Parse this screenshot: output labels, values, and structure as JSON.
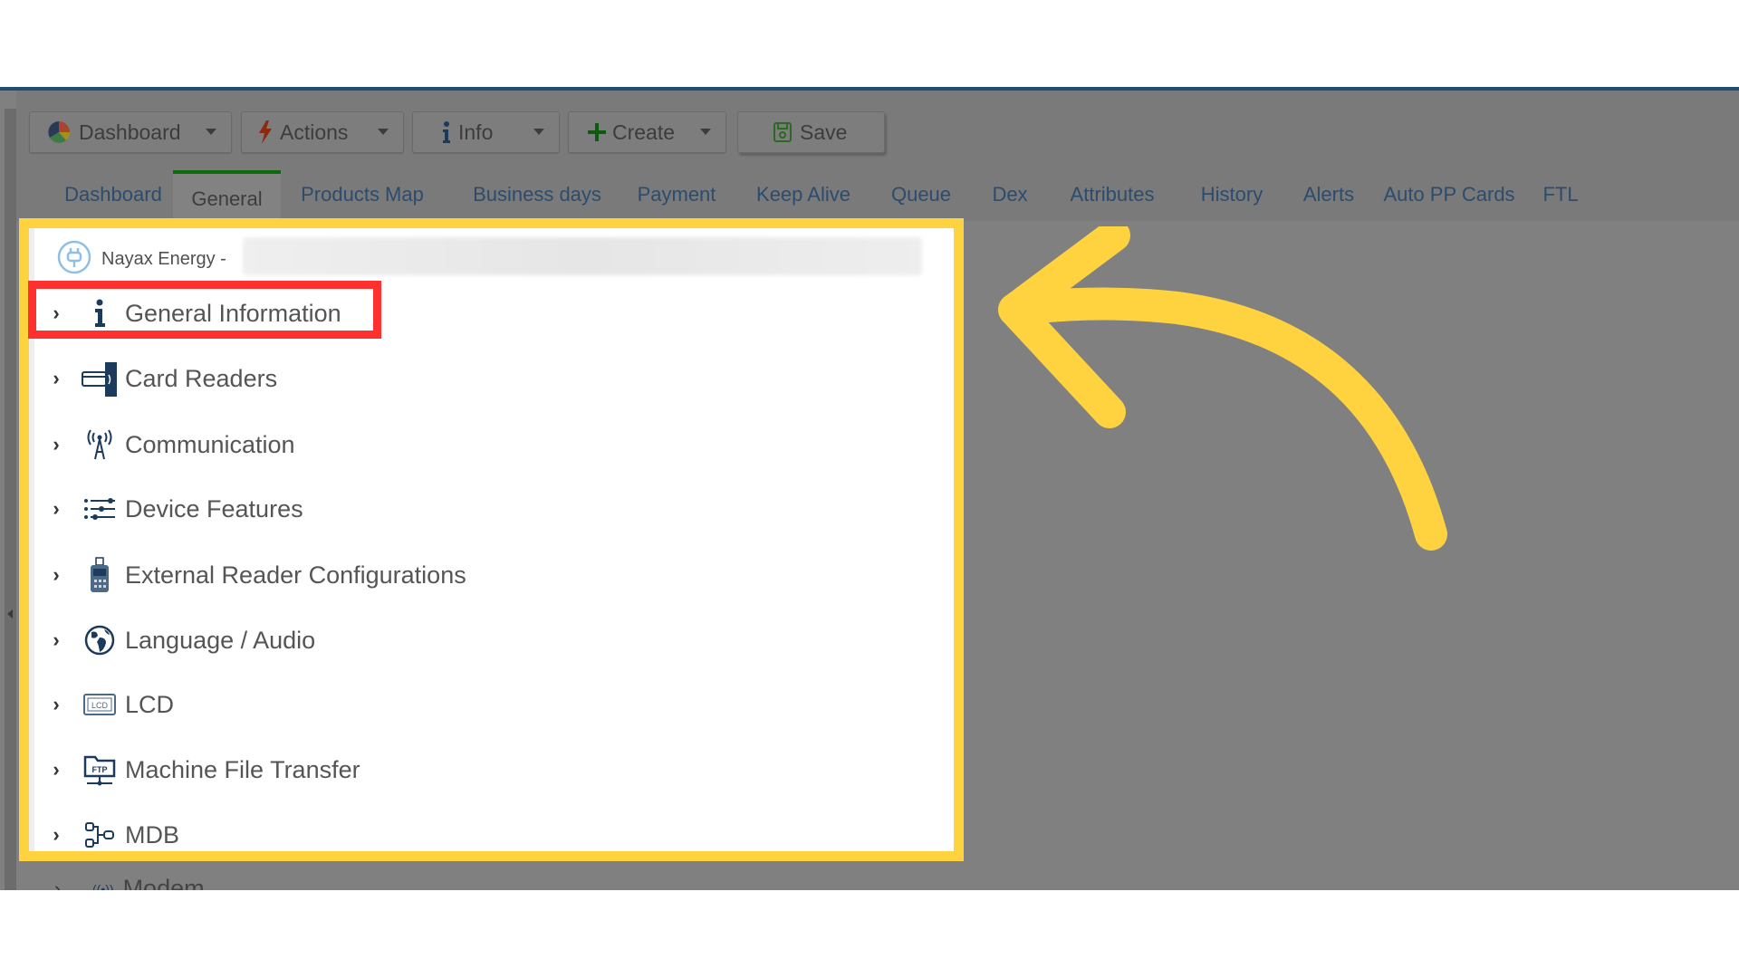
{
  "toolbar": {
    "buttons": [
      {
        "label": "Dashboard",
        "icon": "pie-chart-icon",
        "has_dropdown": true
      },
      {
        "label": "Actions",
        "icon": "lightning-icon",
        "has_dropdown": true
      },
      {
        "label": "Info",
        "icon": "info-icon",
        "has_dropdown": true
      },
      {
        "label": "Create",
        "icon": "plus-icon",
        "has_dropdown": true
      },
      {
        "label": "Save",
        "icon": "floppy-disk-icon",
        "has_dropdown": false
      }
    ]
  },
  "tabs": [
    {
      "label": "Dashboard",
      "active": false
    },
    {
      "label": "General",
      "active": true
    },
    {
      "label": "Products Map",
      "active": false
    },
    {
      "label": "Business days",
      "active": false
    },
    {
      "label": "Payment",
      "active": false
    },
    {
      "label": "Keep Alive",
      "active": false
    },
    {
      "label": "Queue",
      "active": false
    },
    {
      "label": "Dex",
      "active": false
    },
    {
      "label": "Attributes",
      "active": false
    },
    {
      "label": "History",
      "active": false
    },
    {
      "label": "Alerts",
      "active": false
    },
    {
      "label": "Auto PP Cards",
      "active": false
    },
    {
      "label": "FTL",
      "active": false
    }
  ],
  "device": {
    "name_prefix": "Nayax Energy -",
    "icon": "plug-icon"
  },
  "tree": {
    "items": [
      {
        "label": "General Information",
        "icon": "info-icon",
        "highlighted": true
      },
      {
        "label": "Card Readers",
        "icon": "card-reader-icon"
      },
      {
        "label": "Communication",
        "icon": "antenna-icon"
      },
      {
        "label": "Device Features",
        "icon": "sliders-list-icon"
      },
      {
        "label": "External Reader Configurations",
        "icon": "pos-terminal-icon"
      },
      {
        "label": "Language / Audio",
        "icon": "globe-icon"
      },
      {
        "label": "LCD",
        "icon": "lcd-icon"
      },
      {
        "label": "Machine File Transfer",
        "icon": "ftp-icon"
      },
      {
        "label": "MDB",
        "icon": "mdb-connector-icon"
      }
    ],
    "partial_item": "Modem"
  },
  "annotation": {
    "frame_color": "#ffd240",
    "highlight_color": "#ff3030",
    "arrow_color": "#ffd240"
  },
  "colors": {
    "active_tab_accent": "#0b6a0b",
    "tab_link": "#2c4c6e"
  }
}
